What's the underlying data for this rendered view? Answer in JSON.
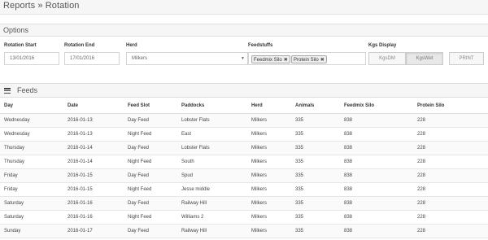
{
  "header": {
    "title": "Reports » Rotation"
  },
  "options": {
    "heading": "Options",
    "rotation_start": {
      "label": "Rotation Start",
      "value": "13/01/2016"
    },
    "rotation_end": {
      "label": "Rotation End",
      "value": "17/01/2016"
    },
    "herd": {
      "label": "Herd",
      "value": "Milkers"
    },
    "feedstuffs": {
      "label": "Feedstuffs",
      "tags": [
        "Feedmix Silo",
        "Protein Silo"
      ]
    },
    "kgs_display": {
      "label": "Kgs Display",
      "options": [
        "KgsDM",
        "KgsWet"
      ],
      "selected": "KgsWet"
    },
    "print_label": "PRINT"
  },
  "feeds": {
    "heading": "Feeds",
    "columns": [
      "Day",
      "Date",
      "Feed Slot",
      "Paddocks",
      "Herd",
      "Animals",
      "Feedmix Silo",
      "Protein Silo"
    ],
    "rows": [
      [
        "Wednesday",
        "2016-01-13",
        "Day Feed",
        "Lobster Flats",
        "Milkers",
        "335",
        "838",
        "228"
      ],
      [
        "Wednesday",
        "2016-01-13",
        "Night Feed",
        "East",
        "Milkers",
        "335",
        "838",
        "228"
      ],
      [
        "Thursday",
        "2016-01-14",
        "Day Feed",
        "Lobster Flats",
        "Milkers",
        "335",
        "838",
        "228"
      ],
      [
        "Thursday",
        "2016-01-14",
        "Night Feed",
        "South",
        "Milkers",
        "335",
        "838",
        "228"
      ],
      [
        "Friday",
        "2016-01-15",
        "Day Feed",
        "Spud",
        "Milkers",
        "335",
        "838",
        "228"
      ],
      [
        "Friday",
        "2016-01-15",
        "Night Feed",
        "Jesse middle",
        "Milkers",
        "335",
        "838",
        "228"
      ],
      [
        "Saturday",
        "2016-01-16",
        "Day Feed",
        "Railway Hill",
        "Milkers",
        "335",
        "838",
        "228"
      ],
      [
        "Saturday",
        "2016-01-16",
        "Night Feed",
        "Williams 2",
        "Milkers",
        "335",
        "838",
        "228"
      ],
      [
        "Sunday",
        "2016-01-17",
        "Day Feed",
        "Railway Hill",
        "Milkers",
        "335",
        "838",
        "228"
      ]
    ]
  }
}
